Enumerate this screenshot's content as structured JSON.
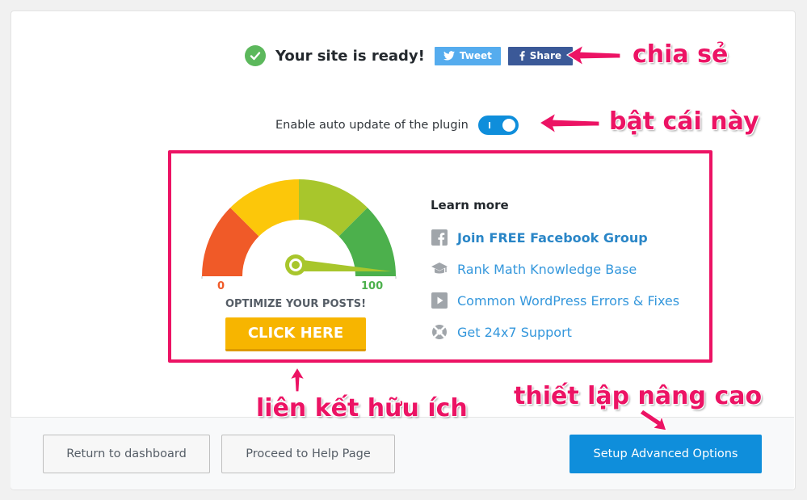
{
  "status": {
    "ready_text": "Your site is ready!",
    "tweet_label": "Tweet",
    "share_label": "Share"
  },
  "auto_update": {
    "label": "Enable auto update of the plugin",
    "enabled": true
  },
  "promo": {
    "gauge_min": "0",
    "gauge_max": "100",
    "headline": "OPTIMIZE YOUR POSTS!",
    "cta_label": "CLICK HERE"
  },
  "learn_more": {
    "title": "Learn more",
    "links": [
      {
        "label": "Join FREE Facebook Group",
        "icon": "facebook-icon"
      },
      {
        "label": "Rank Math Knowledge Base",
        "icon": "graduation-cap-icon"
      },
      {
        "label": "Common WordPress Errors & Fixes",
        "icon": "video-play-icon"
      },
      {
        "label": "Get 24x7 Support",
        "icon": "lifebuoy-icon"
      }
    ]
  },
  "annotations": {
    "share": "chia sẻ",
    "toggle": "bật cái này",
    "links": "liên kết hữu ích",
    "advanced": "thiết lập nâng cao"
  },
  "footer": {
    "return_label": "Return to dashboard",
    "help_label": "Proceed to Help Page",
    "advanced_label": "Setup Advanced Options"
  },
  "colors": {
    "accent": "#0f8edb",
    "annotation": "#ec1364",
    "cta": "#f7b500",
    "success": "#5cb85c",
    "twitter": "#55acee",
    "facebook": "#3b5998"
  }
}
